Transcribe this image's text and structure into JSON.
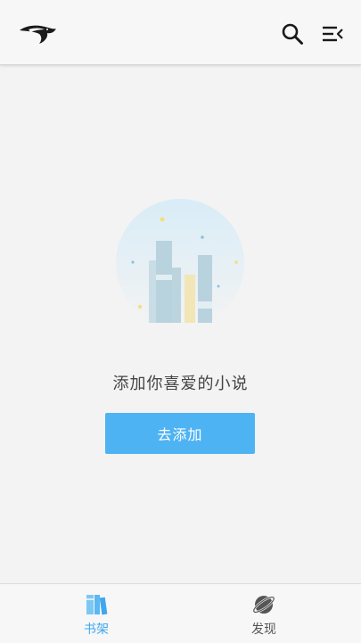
{
  "header": {
    "logo_icon": "bird-logo-icon",
    "search_icon": "search-icon",
    "menu_icon": "menu-icon"
  },
  "empty_state": {
    "illustration_icon": "books-illustration",
    "message": "添加你喜爱的小说",
    "button_label": "去添加"
  },
  "bottom_nav": {
    "items": [
      {
        "label": "书架",
        "icon": "bookshelf-icon",
        "active": true
      },
      {
        "label": "发现",
        "icon": "planet-icon",
        "active": false
      }
    ]
  },
  "colors": {
    "accent": "#4eb3f3",
    "active_tab": "#3ea7ee",
    "background": "#f3f3f3",
    "text": "#444444"
  }
}
